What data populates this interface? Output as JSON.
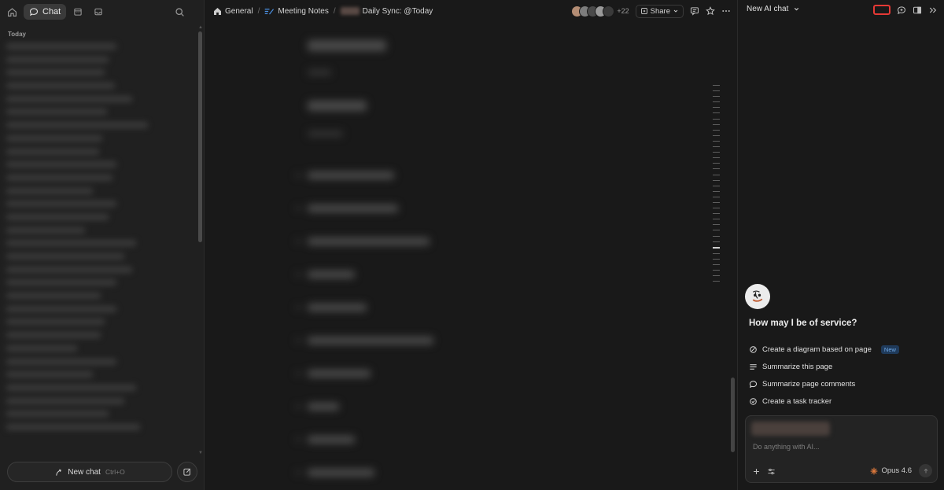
{
  "sidebar": {
    "chat_tab_label": "Chat",
    "section_today": "Today",
    "new_chat_label": "New chat",
    "new_chat_shortcut": "Ctrl+O"
  },
  "topbar": {
    "breadcrumbs": [
      {
        "label": "General",
        "icon": "home-icon"
      },
      {
        "label": "Meeting Notes",
        "icon": "notes-icon"
      },
      {
        "label": "Daily Sync: @Today",
        "icon": "page-icon"
      }
    ],
    "collaborators_more": "+22",
    "share_label": "Share"
  },
  "ai_panel": {
    "title": "New AI chat",
    "greeting": "How may I be of service?",
    "actions": [
      {
        "label": "Create a diagram based on page",
        "icon": "diagram-icon",
        "badge": "New"
      },
      {
        "label": "Summarize this page",
        "icon": "lines-icon"
      },
      {
        "label": "Summarize page comments",
        "icon": "comment-icon"
      },
      {
        "label": "Create a task tracker",
        "icon": "check-circle-icon"
      }
    ],
    "input_placeholder": "Do anything with AI...",
    "model_label": "Opus 4.6"
  },
  "colors": {
    "background": "#191919",
    "sidebar_bg": "#202020",
    "highlight_red": "#e53935",
    "badge_blue": "#6fa8e6",
    "model_accent": "#e07a3c"
  }
}
